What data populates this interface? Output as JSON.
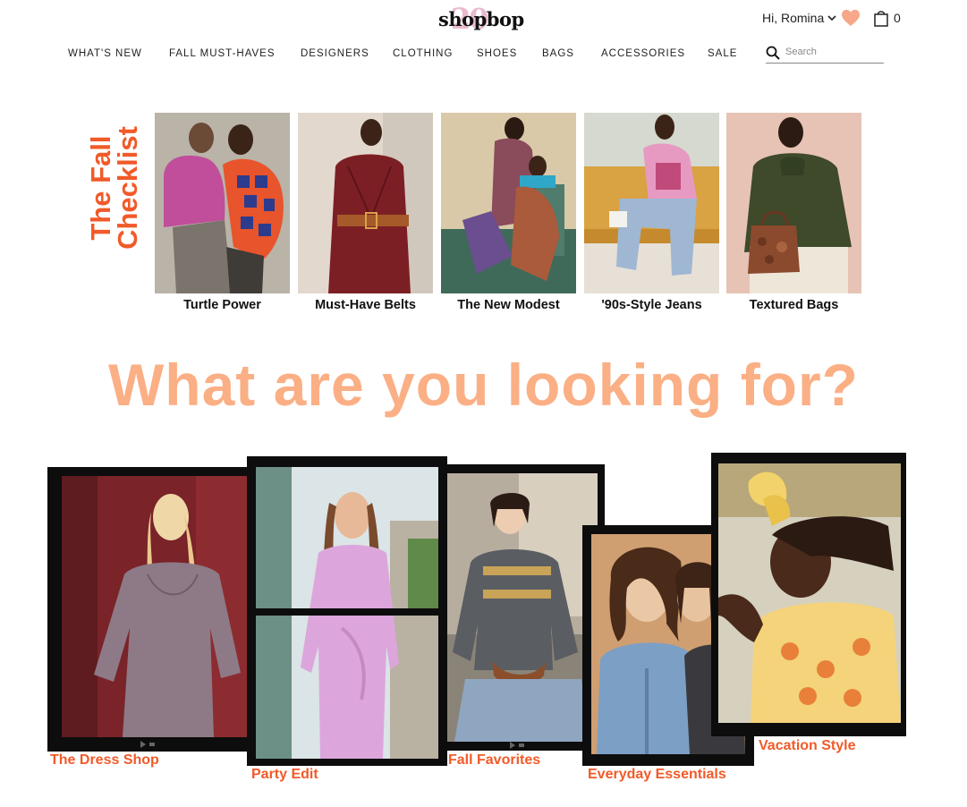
{
  "header": {
    "logo_text": "shopbop",
    "logo_badge": "20",
    "greeting": "Hi, Romina",
    "bag_count": "0",
    "heart_color": "#f7a78a"
  },
  "nav": {
    "items": [
      "WHAT'S NEW",
      "FALL MUST-HAVES",
      "DESIGNERS",
      "CLOTHING",
      "SHOES",
      "BAGS",
      "ACCESSORIES",
      "SALE"
    ],
    "search_placeholder": "Search"
  },
  "checklist": {
    "title_line1": "The Fall",
    "title_line2": "Checklist",
    "title_color": "#f15a29",
    "tiles": [
      {
        "caption": "Turtle Power"
      },
      {
        "caption": "Must-Have Belts"
      },
      {
        "caption": "The New Modest"
      },
      {
        "caption": "'90s-Style Jeans"
      },
      {
        "caption": "Textured Bags"
      }
    ]
  },
  "headline": "What are you looking for?",
  "headline_color": "#fbaf85",
  "categories": [
    {
      "label": "The Dress Shop"
    },
    {
      "label": "Party Edit"
    },
    {
      "label": "Fall Favorites"
    },
    {
      "label": "Everyday Essentials"
    },
    {
      "label": "Vacation Style"
    }
  ]
}
